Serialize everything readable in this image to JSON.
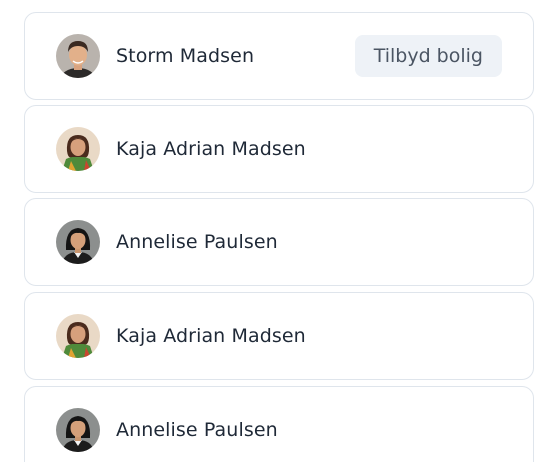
{
  "people": [
    {
      "name": "Storm Madsen",
      "avatar": "man-portrait",
      "action_label": "Tilbyd bolig"
    },
    {
      "name": "Kaja Adrian Madsen",
      "avatar": "woman-colorful-portrait"
    },
    {
      "name": "Annelise Paulsen",
      "avatar": "woman-dark-hair-portrait"
    },
    {
      "name": "Kaja Adrian Madsen",
      "avatar": "woman-colorful-portrait"
    },
    {
      "name": "Annelise Paulsen",
      "avatar": "woman-dark-hair-portrait"
    }
  ],
  "colors": {
    "border": "#dfe5ec",
    "button_bg": "#eef2f7",
    "text": "#1f2937"
  }
}
